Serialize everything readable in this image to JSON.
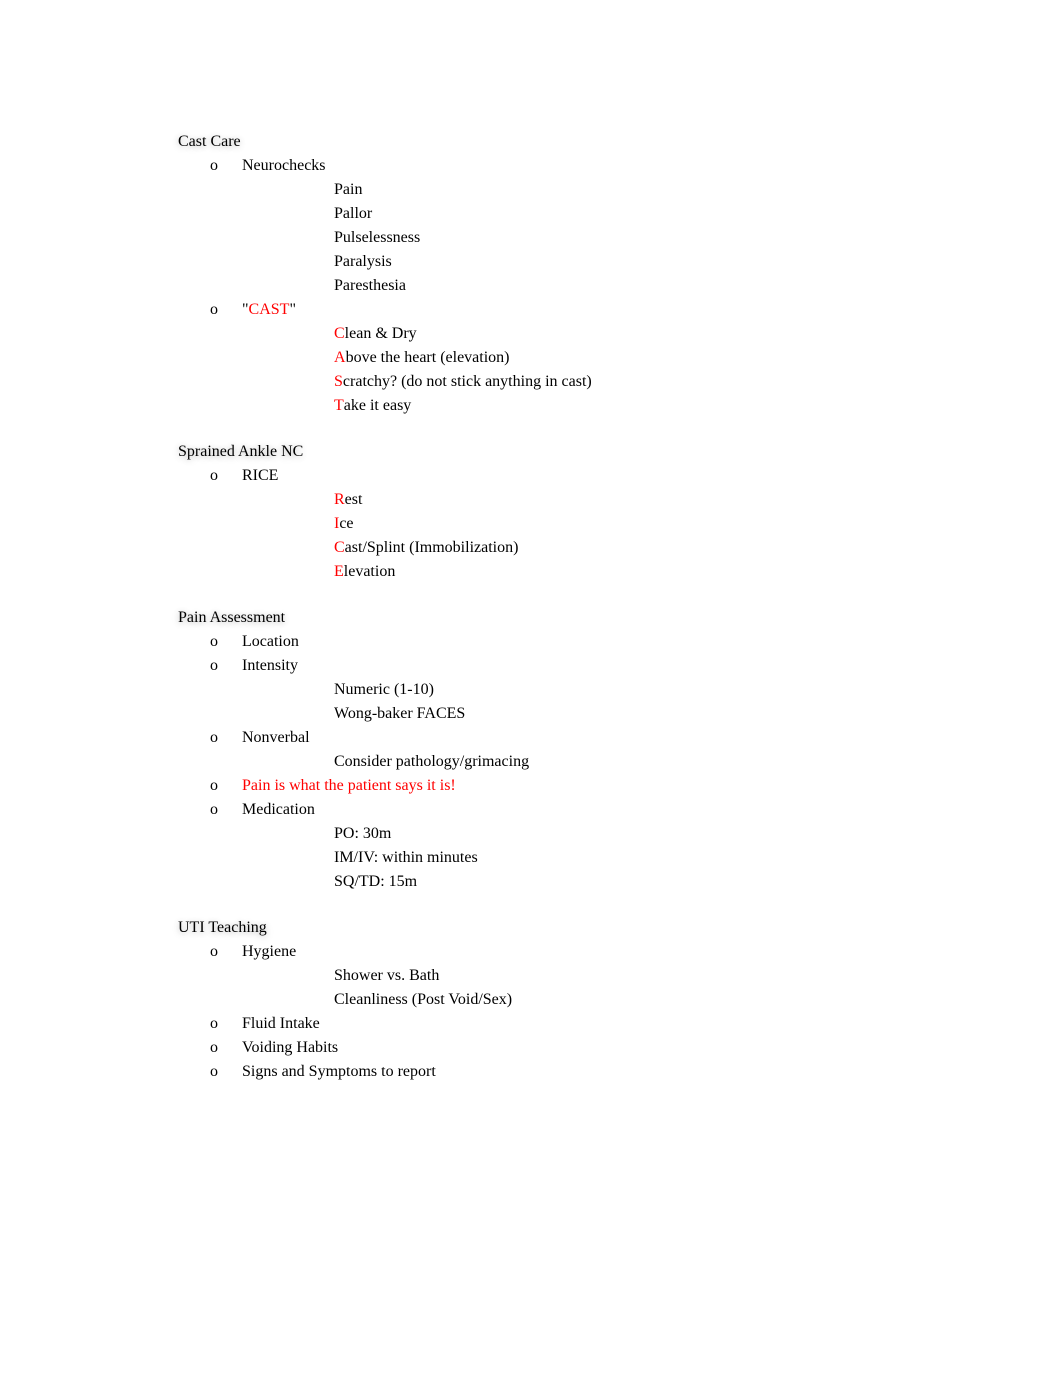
{
  "sections": [
    {
      "heading": "Cast Care",
      "subs": [
        {
          "label": "Neurochecks",
          "items": [
            {
              "text": "Pain"
            },
            {
              "text": "Pallor"
            },
            {
              "text": "Pulselessness"
            },
            {
              "text": "Paralysis"
            },
            {
              "text": "Paresthesia"
            }
          ]
        },
        {
          "label_pre": "\"",
          "label_red": "CAST",
          "label_post": "\"",
          "items": [
            {
              "mn": "C",
              "text": "lean & Dry"
            },
            {
              "mn": "A",
              "text": "bove the heart (elevation)"
            },
            {
              "mn": "S",
              "text": "cratchy? (do not stick anything in cast)"
            },
            {
              "mn": "T",
              "text": "ake it easy"
            }
          ]
        }
      ]
    },
    {
      "heading": "Sprained Ankle NC",
      "subs": [
        {
          "label": "RICE",
          "items": [
            {
              "mn": "R",
              "text": "est"
            },
            {
              "mn": "I",
              "text": "ce"
            },
            {
              "mn": "C",
              "text": "ast/Splint (Immobilization)"
            },
            {
              "mn": "E",
              "text": "levation"
            }
          ]
        }
      ]
    },
    {
      "heading": "Pain Assessment",
      "subs": [
        {
          "label": "Location"
        },
        {
          "label": "Intensity",
          "items": [
            {
              "text": "Numeric (1-10)"
            },
            {
              "text": "Wong-baker FACES"
            }
          ]
        },
        {
          "label": "Nonverbal",
          "items": [
            {
              "text": "Consider pathology/grimacing"
            }
          ]
        },
        {
          "label_red_full": "Pain is what the patient says it is!"
        },
        {
          "label": "Medication",
          "items": [
            {
              "text": "PO: 30m"
            },
            {
              "text": "IM/IV: within minutes"
            },
            {
              "text": "SQ/TD: 15m"
            }
          ]
        }
      ]
    },
    {
      "heading": "UTI Teaching",
      "subs": [
        {
          "label": "Hygiene",
          "items": [
            {
              "text": "Shower vs. Bath"
            },
            {
              "text": "Cleanliness (Post Void/Sex)"
            }
          ]
        },
        {
          "label": "Fluid Intake"
        },
        {
          "label": "Voiding Habits"
        },
        {
          "label": "Signs and Symptoms to report"
        }
      ]
    }
  ],
  "bullets": {
    "l1": "",
    "l2": "o",
    "l3": ""
  }
}
